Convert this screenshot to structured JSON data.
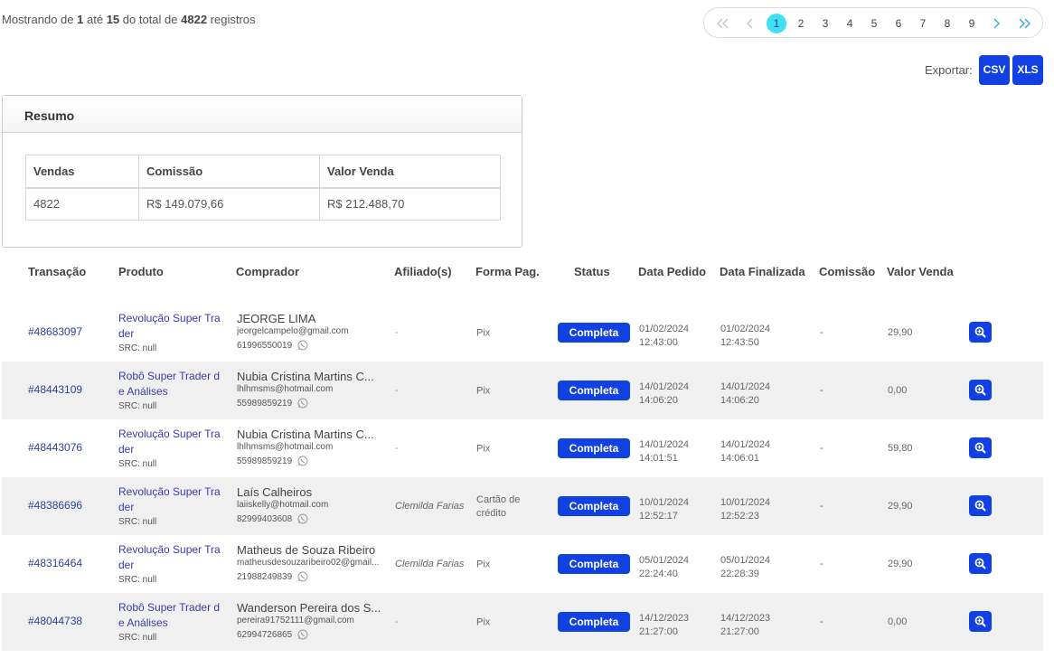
{
  "summary_line": {
    "prefix": "Mostrando de",
    "from": "1",
    "mid": "até",
    "to": "15",
    "mid2": "do total de",
    "total": "4822",
    "suffix": "registros"
  },
  "pagination": {
    "first_icon": "double-chevron-left-icon",
    "prev_icon": "chevron-left-icon",
    "next_icon": "chevron-right-icon",
    "last_icon": "double-chevron-right-icon",
    "pages": [
      "1",
      "2",
      "3",
      "4",
      "5",
      "6",
      "7",
      "8",
      "9"
    ],
    "active_page": "1"
  },
  "export": {
    "label": "Exportar:",
    "csv_label": "CSV",
    "xls_label": "XLS"
  },
  "resumo": {
    "title": "Resumo",
    "headers": [
      "Vendas",
      "Comissão",
      "Valor Venda"
    ],
    "values": [
      "4822",
      "R$ 149.079,66",
      "R$ 212.488,70"
    ]
  },
  "table": {
    "headers": [
      "Transação",
      "Produto",
      "Comprador",
      "Afiliado(s)",
      "Forma Pag.",
      "Status",
      "Data Pedido",
      "Data Finalizada",
      "Comissão",
      "Valor Venda"
    ],
    "rows": [
      {
        "transacao": "#48683097",
        "produto": "Revolução Super Trader",
        "src": "SRC: null",
        "nome": "JEORGE LIMA",
        "email": "jeorgelcampelo@gmail.com",
        "telefone": "61996550019",
        "afiliado": "-",
        "pagamento": "Pix",
        "status": "Completa",
        "data_pedido": "01/02/2024",
        "hora_pedido": "12:43:00",
        "data_final": "01/02/2024",
        "hora_final": "12:43:50",
        "comissao": "-",
        "valor": "29,90"
      },
      {
        "transacao": "#48443109",
        "produto": "Robô Super Trader de Análises",
        "src": "SRC: null",
        "nome": "Nubia Cristina Martins C...",
        "email": "lhlhmsms@hotmail.com",
        "telefone": "55989859219",
        "afiliado": "-",
        "pagamento": "Pix",
        "status": "Completa",
        "data_pedido": "14/01/2024",
        "hora_pedido": "14:06:20",
        "data_final": "14/01/2024",
        "hora_final": "14:06:20",
        "comissao": "-",
        "valor": "0,00"
      },
      {
        "transacao": "#48443076",
        "produto": "Revolução Super Trader",
        "src": "SRC: null",
        "nome": "Nubia Cristina Martins C...",
        "email": "lhlhmsms@hotmail.com",
        "telefone": "55989859219",
        "afiliado": "-",
        "pagamento": "Pix",
        "status": "Completa",
        "data_pedido": "14/01/2024",
        "hora_pedido": "14:01:51",
        "data_final": "14/01/2024",
        "hora_final": "14:06:01",
        "comissao": "-",
        "valor": "59,80"
      },
      {
        "transacao": "#48386696",
        "produto": "Revolução Super Trader",
        "src": "SRC: null",
        "nome": "Laís Calheiros",
        "email": "laiiskelly@hotmail.com",
        "telefone": "82999403608",
        "afiliado": "Clemilda Farias",
        "pagamento": "Cartão de crédito",
        "status": "Completa",
        "data_pedido": "10/01/2024",
        "hora_pedido": "12:52:17",
        "data_final": "10/01/2024",
        "hora_final": "12:52:23",
        "comissao": "-",
        "valor": "29,90"
      },
      {
        "transacao": "#48316464",
        "produto": "Revolução Super Trader",
        "src": "SRC: null",
        "nome": "Matheus de Souza Ribeiro",
        "email": "matheusdesouzaribeiro02@gmail...",
        "telefone": "21988249839",
        "afiliado": "Clemilda Farias",
        "pagamento": "Pix",
        "status": "Completa",
        "data_pedido": "05/01/2024",
        "hora_pedido": "22:24:40",
        "data_final": "05/01/2024",
        "hora_final": "22:28:39",
        "comissao": "-",
        "valor": "29,90"
      },
      {
        "transacao": "#48044738",
        "produto": "Robô Super Trader de Análises",
        "src": "SRC: null",
        "nome": "Wanderson Pereira dos S...",
        "email": "pereira91752111@gmail.com",
        "telefone": "62994726865",
        "afiliado": "-",
        "pagamento": "Pix",
        "status": "Completa",
        "data_pedido": "14/12/2023",
        "hora_pedido": "21:27:00",
        "data_final": "14/12/2023",
        "hora_final": "21:27:00",
        "comissao": "-",
        "valor": "0,00"
      }
    ]
  },
  "colors": {
    "primary": "#1241e3",
    "active_page": "#3ee0f2",
    "link": "#2c3fa3",
    "row_alt": "#f0f0f0"
  },
  "icons": {
    "whatsapp": "whatsapp-icon",
    "details": "search-zoom-icon"
  }
}
